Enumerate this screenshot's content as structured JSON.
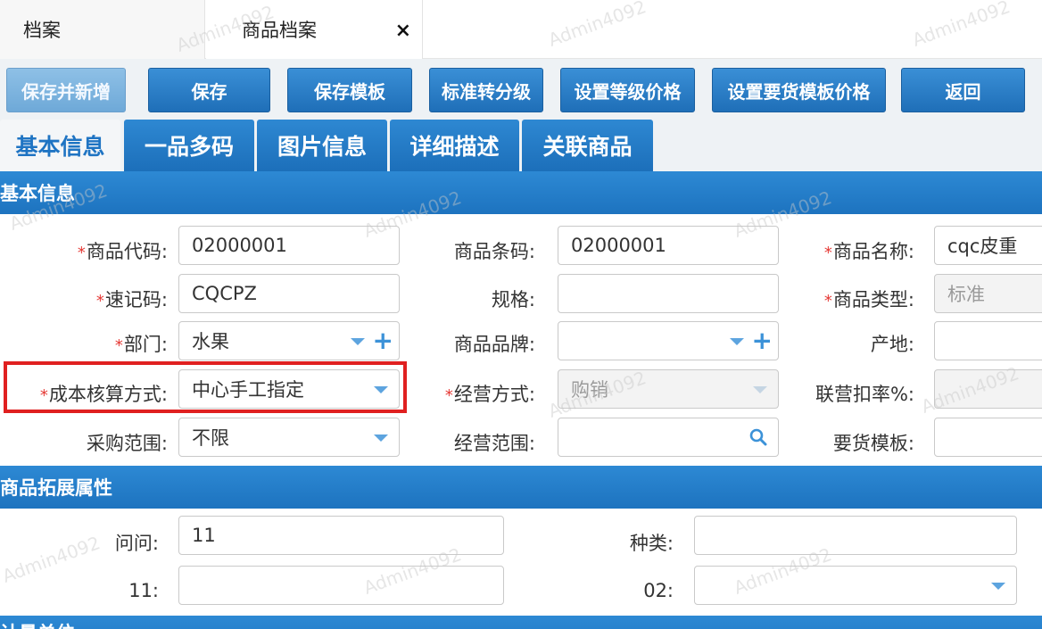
{
  "tabs": {
    "tab1_label": "档案",
    "tab2_label": "商品档案",
    "close_glyph": "×"
  },
  "toolbar": {
    "save_and_new": "保存并新增",
    "save": "保存",
    "save_template": "保存模板",
    "std_to_grade": "标准转分级",
    "set_grade_price": "设置等级价格",
    "set_req_template_price": "设置要货模板价格",
    "back": "返回"
  },
  "sections": {
    "basic_tab": "基本信息",
    "multi_code_tab": "一品多码",
    "image_tab": "图片信息",
    "detail_tab": "详细描述",
    "related_tab": "关联商品",
    "basic_bar": "基本信息",
    "ext_bar": "商品拓展属性",
    "unit_bar": "计量单位"
  },
  "form": {
    "code_label": "商品代码:",
    "code_value": "02000001",
    "barcode_label": "商品条码:",
    "barcode_value": "02000001",
    "name_label": "商品名称:",
    "name_value": "cqc皮重",
    "quick_label": "速记码:",
    "quick_value": "CQCPZ",
    "spec_label": "规格:",
    "spec_value": "",
    "type_label": "商品类型:",
    "type_value": "标准",
    "dept_label": "部门:",
    "dept_value": "水果",
    "brand_label": "商品品牌:",
    "brand_value": "",
    "origin_label": "产地:",
    "origin_value": "",
    "cost_label": "成本核算方式:",
    "cost_value": "中心手工指定",
    "mode_label": "经营方式:",
    "mode_value": "购销",
    "jv_label": "联营扣率%:",
    "jv_value": "",
    "purchase_label": "采购范围:",
    "purchase_value": "不限",
    "biz_label": "经营范围:",
    "biz_value": "",
    "req_label": "要货模板:",
    "req_value": ""
  },
  "ext": {
    "q_label": "问问:",
    "q_value": "11",
    "kind_label": "种类:",
    "kind_value": "",
    "e11_label": "11:",
    "e11_value": "",
    "e02_label": "02:",
    "e02_value": ""
  },
  "watermark": "Admin4092",
  "colors": {
    "accent": "#1f74c3",
    "required": "#e53935",
    "highlight": "#e02020"
  }
}
